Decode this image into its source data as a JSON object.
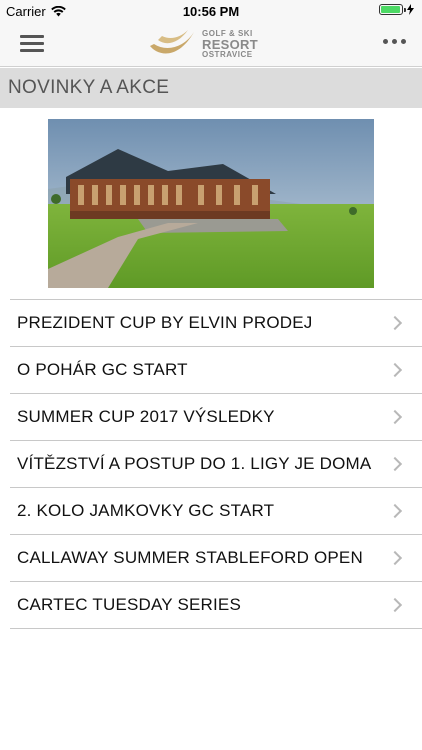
{
  "status_bar": {
    "carrier": "Carrier",
    "time": "10:56 PM",
    "icons": [
      "wifi-icon",
      "battery-icon",
      "charging-icon"
    ]
  },
  "nav": {
    "logo_line1": "GOLF & SKI",
    "logo_line2": "RESORT",
    "logo_line3": "OSTRAVICE",
    "menu_icon": "hamburger-menu-icon",
    "more_icon": "more-dots-icon"
  },
  "section": {
    "title": "NOVINKY A AKCE"
  },
  "news": [
    {
      "title": "PREZIDENT CUP BY ELVIN PRODEJ"
    },
    {
      "title": "O POHÁR GC START"
    },
    {
      "title": "SUMMER CUP 2017 VÝSLEDKY"
    },
    {
      "title": "VÍTĚZSTVÍ A POSTUP DO 1. LIGY JE DOMA"
    },
    {
      "title": "2. KOLO JAMKOVKY GC START"
    },
    {
      "title": "CALLAWAY SUMMER STABLEFORD OPEN"
    },
    {
      "title": "CARTEC TUESDAY SERIES"
    }
  ],
  "colors": {
    "battery": "#4cd964",
    "logo_gold": "#c9a86a",
    "header_bg": "#dcdcdc"
  }
}
